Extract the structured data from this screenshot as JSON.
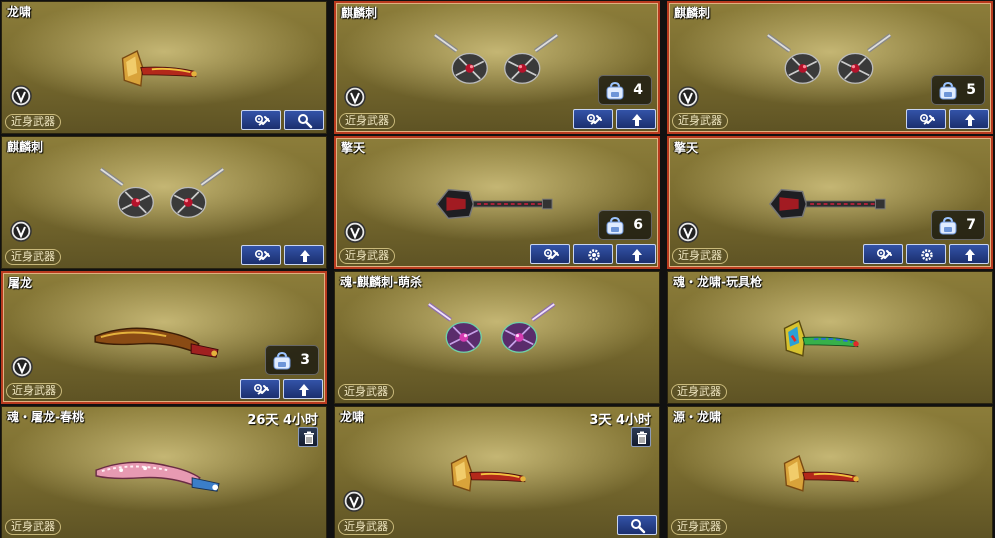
{
  "category_label": "近身武器",
  "cards": [
    {
      "name": "龙啸",
      "timer": "",
      "count": ""
    },
    {
      "name": "麒麟刺",
      "timer": "",
      "count": "4"
    },
    {
      "name": "麒麟刺",
      "timer": "",
      "count": "5"
    },
    {
      "name": "麒麟刺",
      "timer": "",
      "count": ""
    },
    {
      "name": "擎天",
      "timer": "",
      "count": "6"
    },
    {
      "name": "擎天",
      "timer": "",
      "count": "7"
    },
    {
      "name": "屠龙",
      "timer": "",
      "count": "3"
    },
    {
      "name": "魂-麒麟刺-萌杀",
      "timer": "",
      "count": ""
    },
    {
      "name": "魂・龙啸-玩具枪",
      "timer": "",
      "count": ""
    },
    {
      "name": "魂・屠龙-春桃",
      "timer": "26天 4小时",
      "count": ""
    },
    {
      "name": "龙啸",
      "timer": "3天 4小时",
      "count": ""
    },
    {
      "name": "源・龙啸",
      "timer": "",
      "count": ""
    }
  ],
  "icons": {
    "upgrade": "wrench-gear-icon",
    "inspect": "magnifier-icon",
    "arrow": "up-arrow-icon",
    "gear": "gear-icon",
    "trash": "trash-icon",
    "inventory": "backpack-icon",
    "vip": "v-badge-icon"
  },
  "colors": {
    "selected_border": "#b83a1e",
    "button_blue": "#2a4590",
    "card_gold": "#8c7d3a"
  }
}
